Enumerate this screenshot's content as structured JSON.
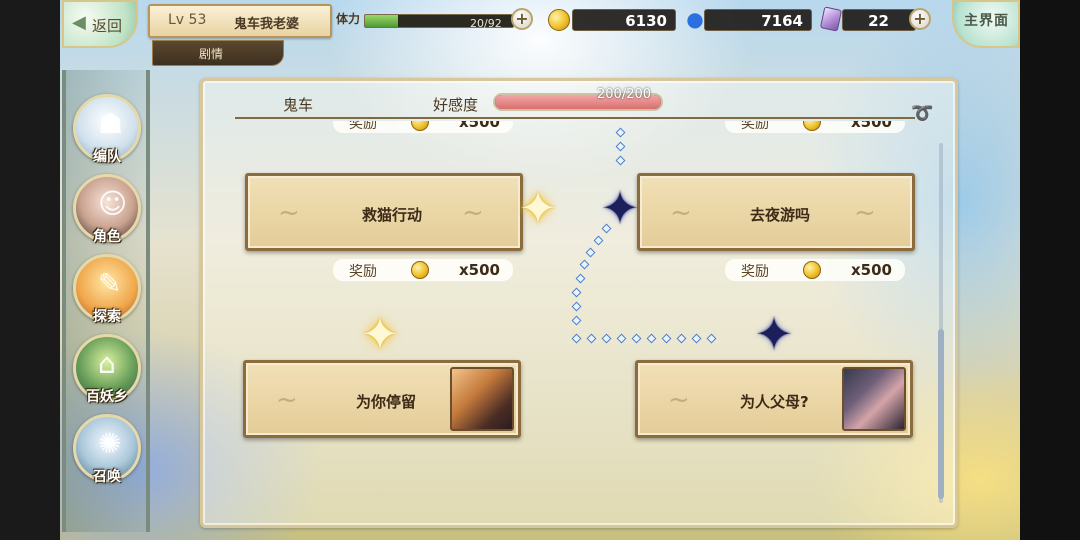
{
  "topbar": {
    "back_label": "返回",
    "level": "Lv 53",
    "player_name": "鬼车我老婆",
    "section_tab": "剧情",
    "stamina_label": "体力",
    "stamina_value": "20/92",
    "stamina_fraction": 0.22,
    "gold": "6130",
    "spirit": "7164",
    "crystal": "22",
    "home_label": "主界面"
  },
  "menu": [
    {
      "label": "编队",
      "icon": "team-icon"
    },
    {
      "label": "角色",
      "icon": "character-icon"
    },
    {
      "label": "探索",
      "icon": "explore-icon"
    },
    {
      "label": "百妖乡",
      "icon": "yokai-village-icon"
    },
    {
      "label": "召唤",
      "icon": "summon-icon"
    }
  ],
  "panel": {
    "character": "鬼车",
    "affinity_label": "好感度",
    "affinity_value": "200/200",
    "affinity_fraction": 1.0
  },
  "stories": [
    {
      "title": "救猫行动",
      "reward_label": "奖励",
      "reward_amount": "x500",
      "unlocked": true
    },
    {
      "title": "去夜游吗",
      "reward_label": "奖励",
      "reward_amount": "x500",
      "unlocked": true
    },
    {
      "title": "为你停留",
      "unlocked": true
    },
    {
      "title": "为人父母?",
      "unlocked": true
    }
  ],
  "partial_rewards": [
    {
      "reward_label": "奖励",
      "reward_amount": "x500"
    },
    {
      "reward_label": "奖励",
      "reward_amount": "x500"
    }
  ],
  "colors": {
    "affinity_fill": "#d96f6f",
    "stamina_fill": "#4f9a33",
    "gold_star": "#f5c53a",
    "navy_star": "#1c1f5a"
  }
}
